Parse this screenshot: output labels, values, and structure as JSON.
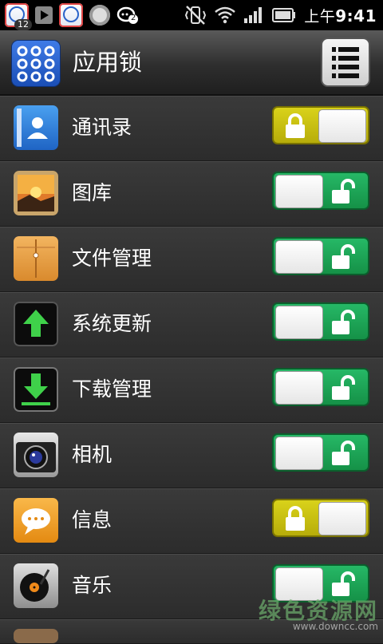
{
  "status_bar": {
    "notification_badge": "12",
    "chat_badge": "2",
    "time_prefix": "上午",
    "time": "9:41"
  },
  "header": {
    "title": "应用锁",
    "app_icon": "pattern-grid-icon",
    "menu_icon": "menu-list-icon"
  },
  "apps": [
    {
      "name": "通讯录",
      "icon": "contacts-icon",
      "locked": true
    },
    {
      "name": "图库",
      "icon": "gallery-icon",
      "locked": false
    },
    {
      "name": "文件管理",
      "icon": "folder-icon",
      "locked": false
    },
    {
      "name": "系统更新",
      "icon": "update-arrow-icon",
      "locked": false
    },
    {
      "name": "下载管理",
      "icon": "download-icon",
      "locked": false
    },
    {
      "name": "相机",
      "icon": "camera-icon",
      "locked": false
    },
    {
      "name": "信息",
      "icon": "message-icon",
      "locked": true
    },
    {
      "name": "音乐",
      "icon": "music-icon",
      "locked": false
    }
  ],
  "watermark": {
    "main": "绿色资源网",
    "sub": "www.downcc.com"
  },
  "colors": {
    "locked_toggle": "#c9c012",
    "unlocked_toggle": "#1ea656",
    "header_bg": "#3a3a3a"
  }
}
